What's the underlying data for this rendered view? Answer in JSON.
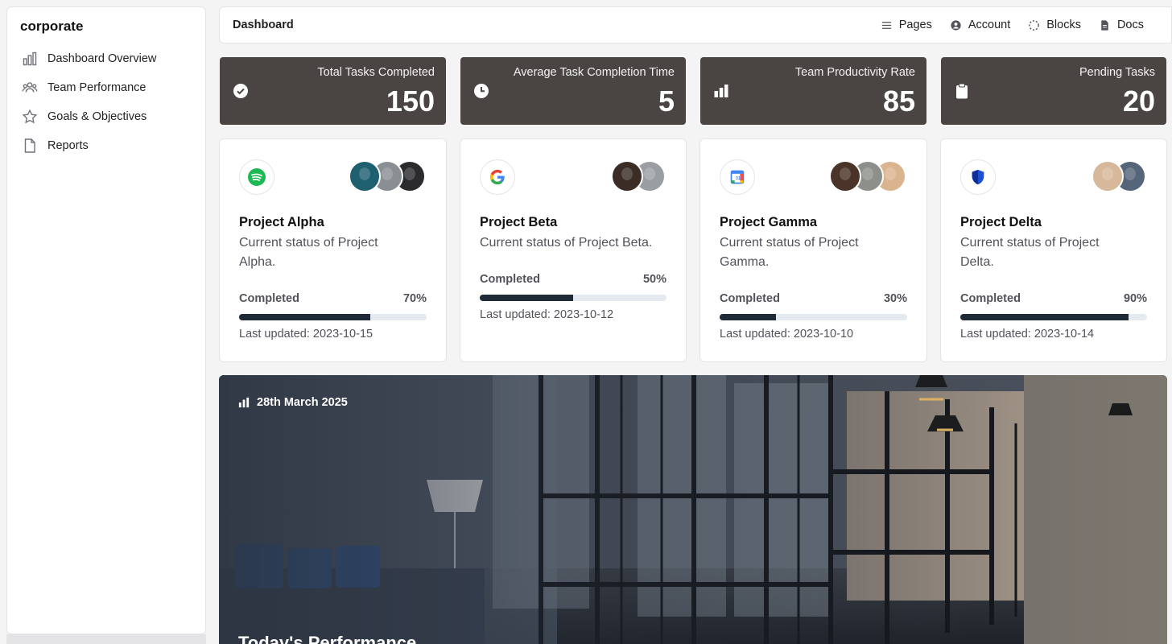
{
  "sidebar": {
    "brand": "corporate",
    "items": [
      {
        "label": "Dashboard Overview",
        "icon": "bar-chart-icon"
      },
      {
        "label": "Team Performance",
        "icon": "users-icon"
      },
      {
        "label": "Goals & Objectives",
        "icon": "star-icon"
      },
      {
        "label": "Reports",
        "icon": "file-icon"
      }
    ]
  },
  "topbar": {
    "title": "Dashboard",
    "nav": [
      {
        "label": "Pages",
        "icon": "menu-lines-icon"
      },
      {
        "label": "Account",
        "icon": "user-circle-icon"
      },
      {
        "label": "Blocks",
        "icon": "dashed-circle-icon"
      },
      {
        "label": "Docs",
        "icon": "document-icon"
      }
    ]
  },
  "stats": [
    {
      "label": "Total Tasks Completed",
      "value": "150",
      "icon": "check-circle-icon"
    },
    {
      "label": "Average Task Completion Time",
      "value": "5",
      "icon": "clock-icon"
    },
    {
      "label": "Team Productivity Rate",
      "value": "85",
      "icon": "bar-chart-icon"
    },
    {
      "label": "Pending Tasks",
      "value": "20",
      "icon": "clipboard-icon"
    }
  ],
  "projects": [
    {
      "title": "Project Alpha",
      "description": "Current status of Project Alpha.",
      "status_label": "Completed",
      "percent_text": "70%",
      "progress": 0.7,
      "updated": "Last updated: 2023-10-15",
      "logo": "spotify-logo-icon",
      "avatar_colors": [
        "#1e5f70",
        "#8a8f93",
        "#2b2b2e"
      ]
    },
    {
      "title": "Project Beta",
      "description": "Current status of Project Beta.",
      "status_label": "Completed",
      "percent_text": "50%",
      "progress": 0.5,
      "updated": "Last updated: 2023-10-12",
      "logo": "google-logo-icon",
      "avatar_colors": [
        "#3b2c26",
        "#9a9ea3"
      ]
    },
    {
      "title": "Project Gamma",
      "description": "Current status of Project Gamma.",
      "status_label": "Completed",
      "percent_text": "30%",
      "progress": 0.3,
      "updated": "Last updated: 2023-10-10",
      "logo": "google-calendar-logo-icon",
      "avatar_colors": [
        "#4a3328",
        "#8d908a",
        "#d9b48f"
      ]
    },
    {
      "title": "Project Delta",
      "description": "Current status of Project Delta.",
      "status_label": "Completed",
      "percent_text": "90%",
      "progress": 0.9,
      "updated": "Last updated: 2023-10-14",
      "logo": "shield-logo-icon",
      "avatar_colors": [
        "#d7b89a",
        "#55657a"
      ]
    }
  ],
  "hero": {
    "date": "28th March 2025",
    "heading": "Today's Performance"
  }
}
